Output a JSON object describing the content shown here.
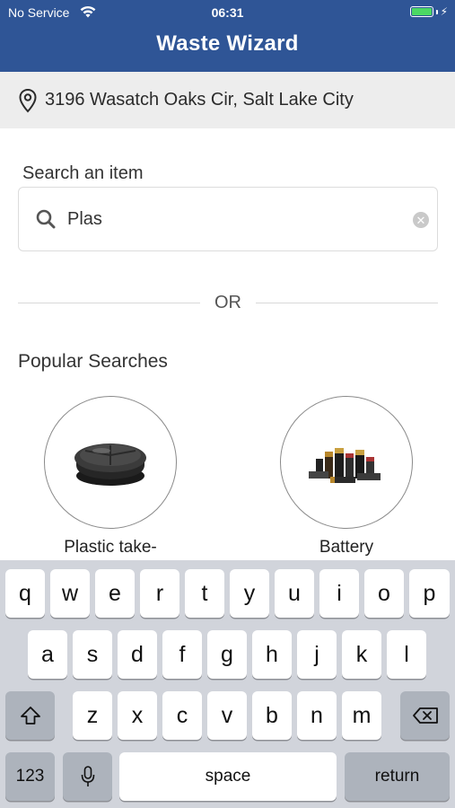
{
  "status_bar": {
    "carrier": "No Service",
    "time": "06:31"
  },
  "header": {
    "title": "Waste Wizard"
  },
  "address": {
    "text": "3196 Wasatch Oaks Cir, Salt Lake City"
  },
  "search": {
    "label": "Search an item",
    "value": "Plas"
  },
  "divider": {
    "or_text": "OR"
  },
  "popular": {
    "title": "Popular Searches",
    "items": [
      {
        "label": "Plastic take-",
        "image": "plastic-container"
      },
      {
        "label": "Battery",
        "image": "batteries"
      }
    ]
  },
  "keyboard": {
    "row1": [
      "q",
      "w",
      "e",
      "r",
      "t",
      "y",
      "u",
      "i",
      "o",
      "p"
    ],
    "row2": [
      "a",
      "s",
      "d",
      "f",
      "g",
      "h",
      "j",
      "k",
      "l"
    ],
    "row3": [
      "z",
      "x",
      "c",
      "v",
      "b",
      "n",
      "m"
    ],
    "numbers_label": "123",
    "space_label": "space",
    "return_label": "return"
  },
  "colors": {
    "header_bg": "#2f5596",
    "address_bg": "#ededed",
    "keyboard_bg": "#d1d4db"
  }
}
